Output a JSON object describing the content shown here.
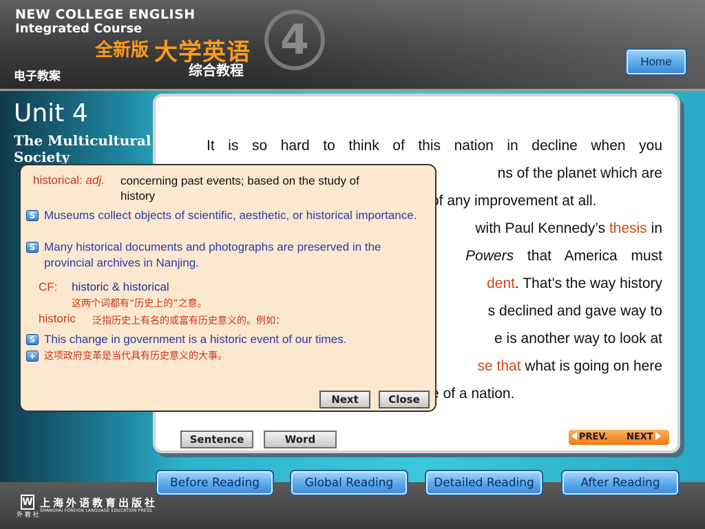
{
  "header": {
    "brand_line1": "NEW COLLEGE ENGLISH",
    "brand_line2": "Integrated Course",
    "brand_sub": "全新版",
    "brand_main": "大学英语",
    "brand_course": "综合教程",
    "volume_number": "4",
    "ecourse_label": "电子教案",
    "home_label": "Home"
  },
  "unit": {
    "title": "Unit 4",
    "subtitle_line1": "The Multicultural",
    "subtitle_line2": "Society"
  },
  "passage": {
    "line1": "It is so hard to think of this nation in decline when you",
    "line2_tail": "ns of the planet which are",
    "line3_tail": "of any improvement at all.",
    "line4_tail": "with Paul Kennedy’s ",
    "line4_highlight": "thesis",
    "line4_end": " in",
    "line5_italic": "Powers",
    "line5_end": " that America must",
    "line6_highlight": "dent",
    "line6_end": ". That’s the way history",
    "line7_tail": "s declined and gave way to",
    "line8_tail": "e is another way to look at",
    "line9_highlight": "se that",
    "line9_end": " what is going on here",
    "line10_tail": "e of a nation."
  },
  "popup": {
    "term": "historical:",
    "pos": "adj.",
    "definition": "concerning past events; based on the study of  history",
    "example1": "Museums collect objects of scientific, aesthetic, or historical importance.",
    "example2": "Many historical documents and photographs are preserved in the provincial archives in Nanjing.",
    "cf_label": "CF:",
    "cf_text": "historic & historical",
    "cf_note": "这两个词都有“历史上的”之意。",
    "historic_word": "historic",
    "historic_note": "泛指历史上有名的或富有历史意义的。例如：",
    "example3": "This change in government is a historic event of our times.",
    "example3_translation": "这项政府变革是当代具有历史意义的大事。",
    "sound_icon_glyph": "S",
    "translation_icon_glyph": "+",
    "next_label": "Next",
    "close_label": "Close"
  },
  "tools": {
    "sentence_label": "Sentence",
    "word_label": "Word",
    "prev_label": "PREV.",
    "next_label": "NEXT"
  },
  "nav": {
    "before_reading": "Before Reading",
    "global_reading": "Global Reading",
    "detailed_reading": "Detailed Reading",
    "after_reading": "After Reading"
  },
  "footer": {
    "logo_glyph": "W",
    "logo_sub": "外 教 社",
    "publisher_cn": "上海外语教育出版社",
    "publisher_en": "SHANGHAI FOREIGN LANGUAGE EDUCATION PRESS"
  },
  "colors": {
    "highlight": "#d04a12",
    "example_blue": "#2a3aa8",
    "brand_orange": "#ff9b1a",
    "nav_blue": "#5aa8ec",
    "popup_bg": "#fbe8cf"
  }
}
